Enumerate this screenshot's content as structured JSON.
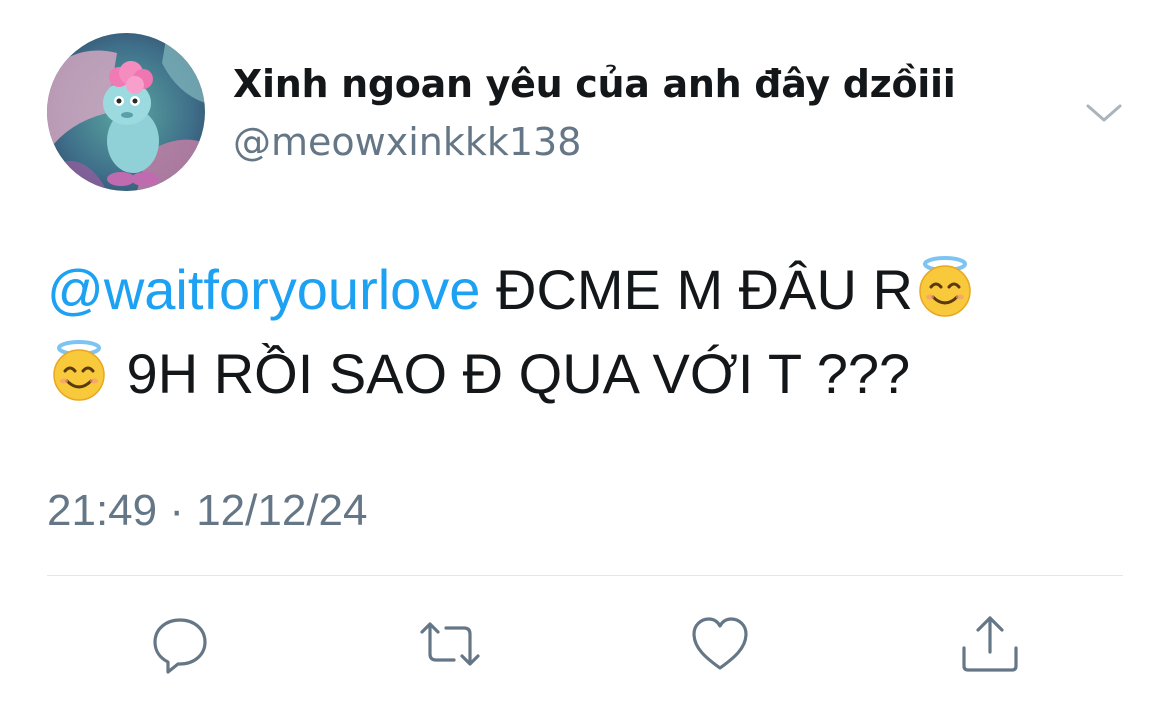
{
  "tweet": {
    "display_name": "Xinh ngoan yêu của anh đây dzồiii",
    "handle": "@meowxinkkk138",
    "mention": "@waitforyourlove",
    "text_part1": " ĐCME M ĐÂU R",
    "text_part2": " 9H RỒI SAO Đ QUA VỚI T ???",
    "timestamp": "21:49 · 12/12/24"
  },
  "icons": {
    "more": "chevron-down-icon",
    "reply": "reply-icon",
    "retweet": "retweet-icon",
    "like": "heart-icon",
    "share": "share-icon",
    "emoji": "smiling-face-with-halo-emoji"
  },
  "colors": {
    "text": "#14171a",
    "secondary": "#657786",
    "mention": "#1da1f2",
    "divider": "#e1e8ed",
    "icon": "#657786"
  }
}
